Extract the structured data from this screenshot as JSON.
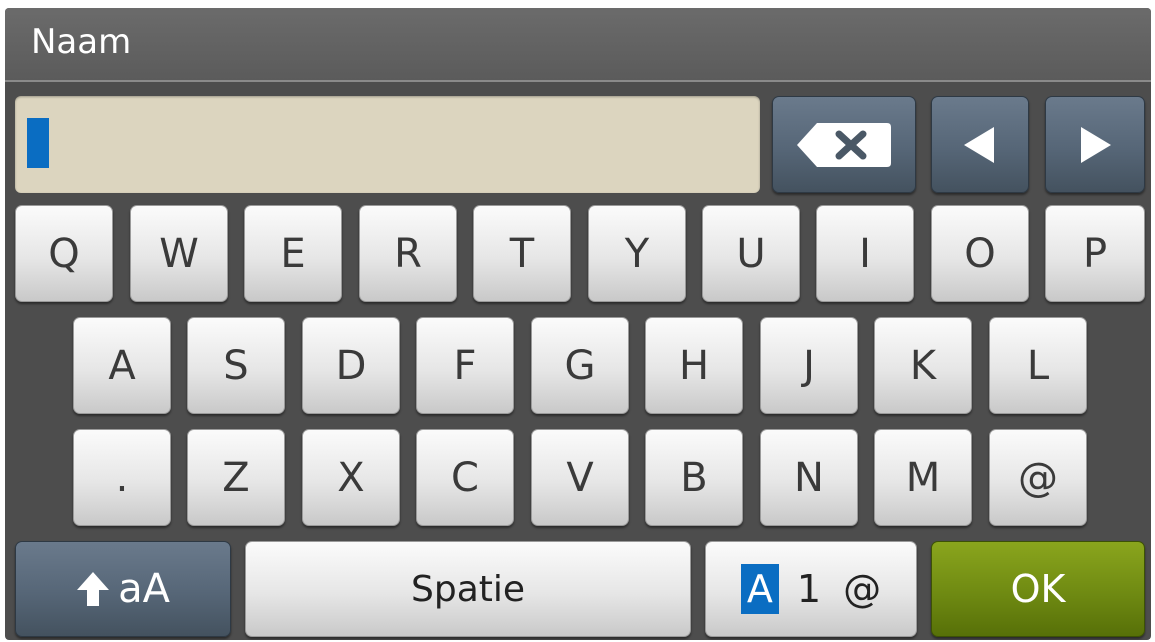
{
  "title": "Naam",
  "input": {
    "value": ""
  },
  "controls": {
    "backspace_icon": "backspace-icon",
    "left_icon": "arrow-left-icon",
    "right_icon": "arrow-right-icon"
  },
  "keyboard": {
    "row1": [
      "Q",
      "W",
      "E",
      "R",
      "T",
      "Y",
      "U",
      "I",
      "O",
      "P"
    ],
    "row2": [
      "A",
      "S",
      "D",
      "F",
      "G",
      "H",
      "J",
      "K",
      "L"
    ],
    "row3": [
      ".",
      "Z",
      "X",
      "C",
      "V",
      "B",
      "N",
      "M",
      "@"
    ]
  },
  "bottom": {
    "shift_label": "aA",
    "shift_icon": "shift-arrow-icon",
    "space_label": "Spatie",
    "mode_letters": "A",
    "mode_numbers": "1",
    "mode_symbols": "@",
    "ok_label": "OK"
  },
  "colors": {
    "accent_blue": "#0a6dc2",
    "ok_green": "#6f8a12",
    "input_bg": "#dcd5bf"
  }
}
